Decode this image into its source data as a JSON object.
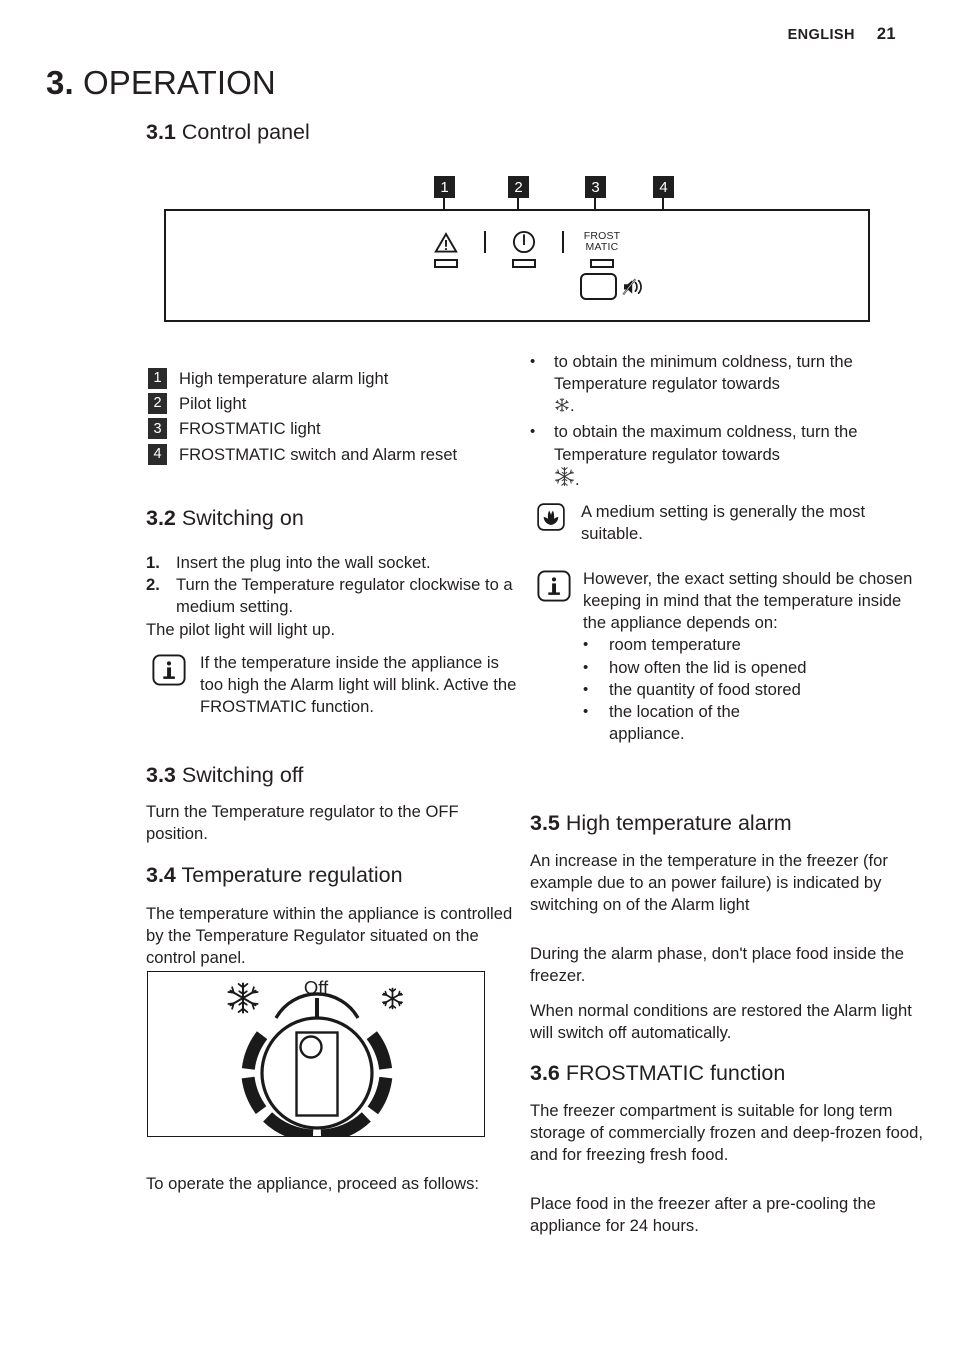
{
  "header": {
    "language": "ENGLISH",
    "page_number": "21"
  },
  "chapter": {
    "number": "3.",
    "title": "OPERATION"
  },
  "sections": {
    "control_panel": {
      "number": "3.1",
      "title": "Control panel"
    },
    "switching_on": {
      "number": "3.2",
      "title": "Switching on",
      "steps": [
        {
          "marker": "1.",
          "text": "Insert the plug into the wall socket."
        },
        {
          "marker": "2.",
          "text": "Turn the Temperature regulator clockwise to a medium setting."
        }
      ],
      "after_steps": "The pilot light will light up.",
      "note": {
        "icon": "info-icon",
        "text": "If the temperature inside the appliance is too high the Alarm light will blink. Active the FROSTMATIC function."
      }
    },
    "switching_off": {
      "number": "3.3",
      "title": "Switching off",
      "body": "Turn the Temperature regulator to the OFF position."
    },
    "temperature_regulation": {
      "number": "3.4",
      "title": "Temperature regulation",
      "body": "The temperature within the appliance is controlled by the Temperature Regulator situated on the control panel.",
      "after_figure": "To operate the appliance, proceed as follows:",
      "bullets": [
        "to obtain the minimum coldness, turn the Temperature regulator towards",
        "to obtain the maximum coldness, turn the Temperature regulator towards"
      ],
      "bullet_suffix": ".",
      "tip": {
        "icon": "tulip-icon",
        "text": "A medium setting is generally the most suitable."
      },
      "note": {
        "icon": "info-icon",
        "text": "However, the exact setting should be chosen keeping in mind that the temperature inside the appliance depends on:",
        "factors": [
          "room temperature",
          "how often the lid is opened",
          "the quantity of food stored",
          "the location of the appliance."
        ]
      }
    },
    "high_temperature_alarm": {
      "number": "3.5",
      "title": "High temperature alarm",
      "paragraphs": [
        "An increase in the temperature in the freezer (for example due to an power failure) is indicated by switching on of the Alarm light",
        "During the alarm phase, don't place food inside the freezer.",
        "When normal conditions are restored the Alarm light will switch off automatically."
      ]
    },
    "frostmatic_function": {
      "number": "3.6",
      "title": "FROSTMATIC function",
      "paragraphs": [
        "The freezer compartment is suitable for long term storage of commercially frozen and deep-frozen food, and for freezing fresh food.",
        "Place food in the freezer after a pre-cooling the appliance for 24 hours."
      ]
    }
  },
  "control_panel_figure": {
    "callouts": [
      {
        "number": "1",
        "target": "warning-triangle-indicator"
      },
      {
        "number": "2",
        "target": "pilot-power-indicator"
      },
      {
        "number": "3",
        "target": "frostmatic-indicator"
      },
      {
        "number": "4",
        "target": "frostmatic-alarm-reset-button"
      }
    ],
    "frostmatic_label_line1": "FROST",
    "frostmatic_label_line2": "MATIC",
    "button_icon": "muted-speaker-icon"
  },
  "legend": [
    {
      "number": "1",
      "label": "High temperature alarm light"
    },
    {
      "number": "2",
      "label": "Pilot light"
    },
    {
      "number": "3",
      "label": "FROSTMATIC light"
    },
    {
      "number": "4",
      "label": "FROSTMATIC switch and Alarm reset"
    }
  ],
  "dial_figure": {
    "off_label": "Off",
    "left_symbol": "large-snowflake-icon",
    "right_symbol": "small-snowflake-icon"
  }
}
